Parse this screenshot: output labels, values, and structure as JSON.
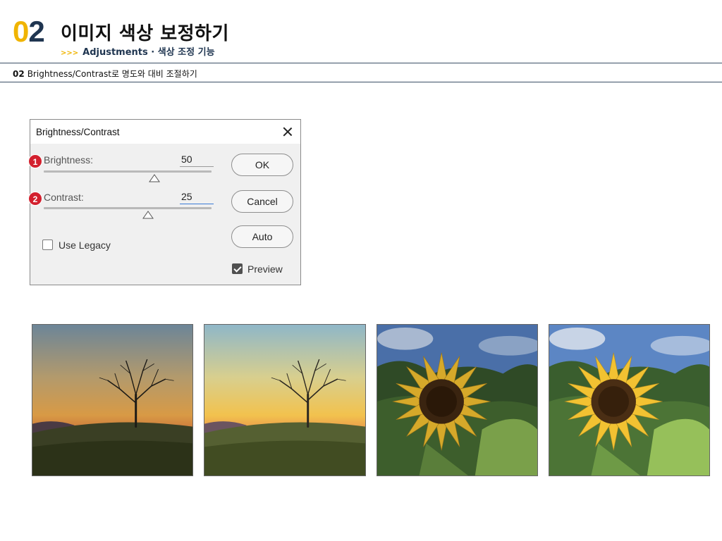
{
  "header": {
    "chapter_digit_1": "0",
    "chapter_digit_2": "2",
    "title": "이미지 색상 보정하기",
    "sub_arrows": ">>>",
    "subtitle": "Adjustments · 색상 조정 기능",
    "accent_color": "#f0b400",
    "navy_color": "#1f3550"
  },
  "section": {
    "number": "02",
    "title": "Brightness/Contrast로 명도와 대비 조절하기"
  },
  "dialog": {
    "title": "Brightness/Contrast",
    "brightness": {
      "badge": "1",
      "label": "Brightness:",
      "value": "50",
      "slider_fraction": 0.66
    },
    "contrast": {
      "badge": "2",
      "label": "Contrast:",
      "value": "25",
      "slider_fraction": 0.62
    },
    "use_legacy": {
      "label": "Use Legacy",
      "checked": false
    },
    "preview": {
      "label": "Preview",
      "checked": true
    },
    "buttons": {
      "ok": "OK",
      "cancel": "Cancel",
      "auto": "Auto"
    },
    "badge_color": "#d3202e"
  },
  "photos": [
    {
      "subject": "tree-sunset",
      "variant": "before"
    },
    {
      "subject": "tree-sunset",
      "variant": "after"
    },
    {
      "subject": "sunflower",
      "variant": "before"
    },
    {
      "subject": "sunflower",
      "variant": "after"
    }
  ]
}
